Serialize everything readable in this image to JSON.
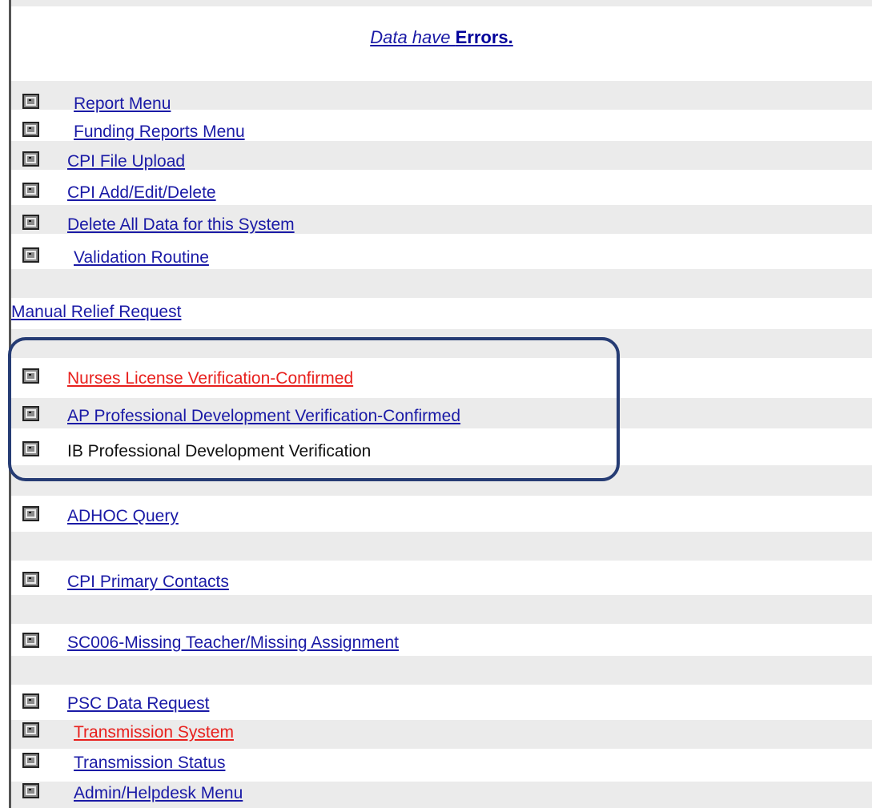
{
  "header": {
    "prefix": "Data have",
    "emphasis": "Errors."
  },
  "menu_top": [
    {
      "label": "Report Menu",
      "icon": "menu-doc-icon"
    },
    {
      "label": "Funding Reports Menu",
      "icon": "menu-doc-icon"
    },
    {
      "label": "CPI File Upload",
      "icon": "menu-doc-icon"
    },
    {
      "label": "CPI Add/Edit/Delete",
      "icon": "menu-doc-icon"
    },
    {
      "label": "Delete All Data for this System",
      "icon": "menu-doc-icon"
    },
    {
      "label": "Validation Routine",
      "icon": "menu-doc-icon"
    }
  ],
  "manual_relief": "Manual Relief Request",
  "verification_items": [
    {
      "label": "Nurses License Verification-Confirmed",
      "color": "#e8201d"
    },
    {
      "label": "AP Professional Development Verification-Confirmed",
      "color": "#1a1aa6"
    },
    {
      "label": "IB Professional Development Verification",
      "color": "#111111"
    }
  ],
  "menu_bottom": [
    {
      "label": "ADHOC Query"
    },
    {
      "label": "CPI Primary Contacts"
    },
    {
      "label": "SC006-Missing Teacher/Missing Assignment"
    },
    {
      "label": "PSC Data Request"
    },
    {
      "label": "Transmission System",
      "color": "#e8201d"
    },
    {
      "label": "Transmission Status"
    },
    {
      "label": "Admin/Helpdesk Menu"
    }
  ],
  "colors": {
    "link": "#1a1aa6",
    "alert_link": "#e8201d",
    "band": "#ebebeb",
    "highlight_border": "#263c74"
  }
}
